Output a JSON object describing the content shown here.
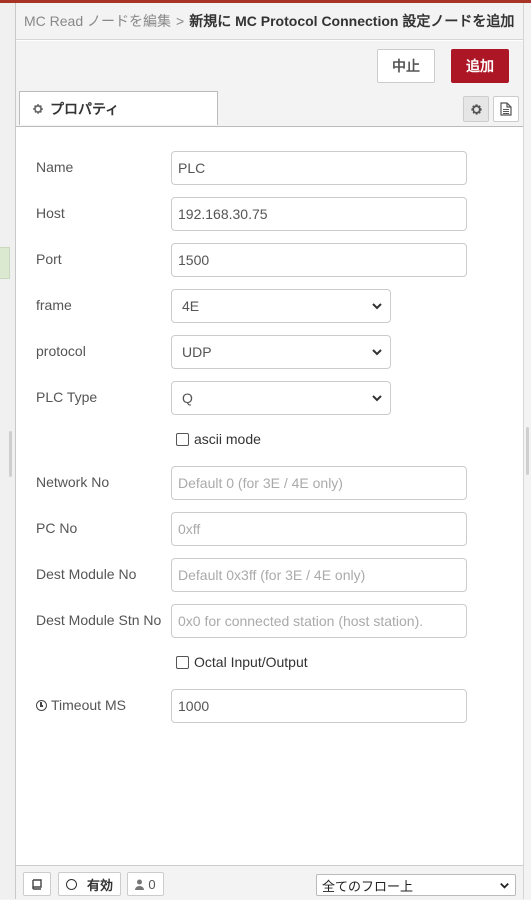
{
  "header": {
    "parent": "MC Read ノードを編集",
    "separator": ">",
    "current": "新規に MC Protocol Connection 設定ノードを追加"
  },
  "toolbar": {
    "cancel_label": "中止",
    "add_label": "追加"
  },
  "tabs": {
    "properties_label": "プロパティ"
  },
  "form": {
    "name": {
      "label": "Name",
      "value": "PLC"
    },
    "host": {
      "label": "Host",
      "value": "192.168.30.75"
    },
    "port": {
      "label": "Port",
      "value": "1500"
    },
    "frame": {
      "label": "frame",
      "value": "4E"
    },
    "protocol": {
      "label": "protocol",
      "value": "UDP"
    },
    "plc_type": {
      "label": "PLC Type",
      "value": "Q"
    },
    "ascii_mode": {
      "label": "ascii mode",
      "checked": false
    },
    "network_no": {
      "label": "Network No",
      "placeholder": "Default 0 (for 3E / 4E only)"
    },
    "pc_no": {
      "label": "PC No",
      "placeholder": "0xff"
    },
    "dest_module_no": {
      "label": "Dest Module No",
      "placeholder": "Default 0x3ff (for 3E / 4E only)"
    },
    "dest_module_stn_no": {
      "label": "Dest Module Stn No",
      "placeholder": "0x0 for connected station (host station)."
    },
    "octal_io": {
      "label": "Octal Input/Output",
      "checked": false
    },
    "timeout": {
      "label": "Timeout MS",
      "value": "1000"
    }
  },
  "footer": {
    "enabled_label": "有効",
    "user_count": "0",
    "scope_value": "全てのフロー上"
  },
  "colors": {
    "accent": "#ad1625",
    "top_line": "#a83327"
  }
}
